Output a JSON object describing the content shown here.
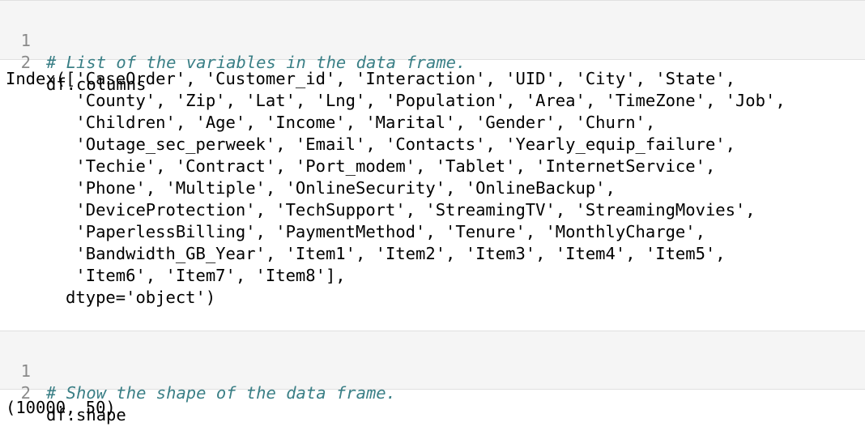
{
  "cells": [
    {
      "lines": [
        {
          "number": "1",
          "text": "# List of the variables in the data frame."
        },
        {
          "number": "2",
          "text": "df.columns"
        }
      ],
      "output": "Index(['CaseOrder', 'Customer_id', 'Interaction', 'UID', 'City', 'State',\n       'County', 'Zip', 'Lat', 'Lng', 'Population', 'Area', 'TimeZone', 'Job',\n       'Children', 'Age', 'Income', 'Marital', 'Gender', 'Churn',\n       'Outage_sec_perweek', 'Email', 'Contacts', 'Yearly_equip_failure',\n       'Techie', 'Contract', 'Port_modem', 'Tablet', 'InternetService',\n       'Phone', 'Multiple', 'OnlineSecurity', 'OnlineBackup',\n       'DeviceProtection', 'TechSupport', 'StreamingTV', 'StreamingMovies',\n       'PaperlessBilling', 'PaymentMethod', 'Tenure', 'MonthlyCharge',\n       'Bandwidth_GB_Year', 'Item1', 'Item2', 'Item3', 'Item4', 'Item5',\n       'Item6', 'Item7', 'Item8'],\n      dtype='object')"
    },
    {
      "lines": [
        {
          "number": "1",
          "text": "# Show the shape of the data frame."
        },
        {
          "number": "2",
          "text": "df.shape"
        }
      ],
      "output": "(10000, 50)"
    }
  ],
  "colors": {
    "cell_background": "#f5f5f5",
    "comment": "#3a7f86",
    "line_number": "#8a8a8a"
  }
}
